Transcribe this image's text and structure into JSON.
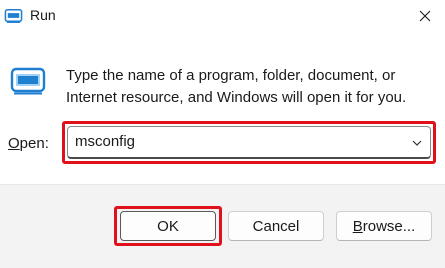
{
  "window": {
    "title": "Run",
    "close_symbol": "✕"
  },
  "icons": {
    "title_icon": "run-icon",
    "app_icon": "run-icon",
    "close_icon": "close-icon",
    "dropdown_icon": "chevron-down-icon"
  },
  "description": "Type the name of a program, folder, document, or Internet resource, and Windows will open it for you.",
  "open_field": {
    "label_mnemonic": "O",
    "label_rest": "pen:",
    "value": "msconfig"
  },
  "buttons": {
    "ok": "OK",
    "cancel": "Cancel",
    "browse_mnemonic": "B",
    "browse_rest": "rowse..."
  },
  "colors": {
    "highlight": "#e0111a",
    "icon_blue": "#1f7fd1",
    "icon_light": "#9fd2f5",
    "footer_bg": "#f3f3f3"
  }
}
